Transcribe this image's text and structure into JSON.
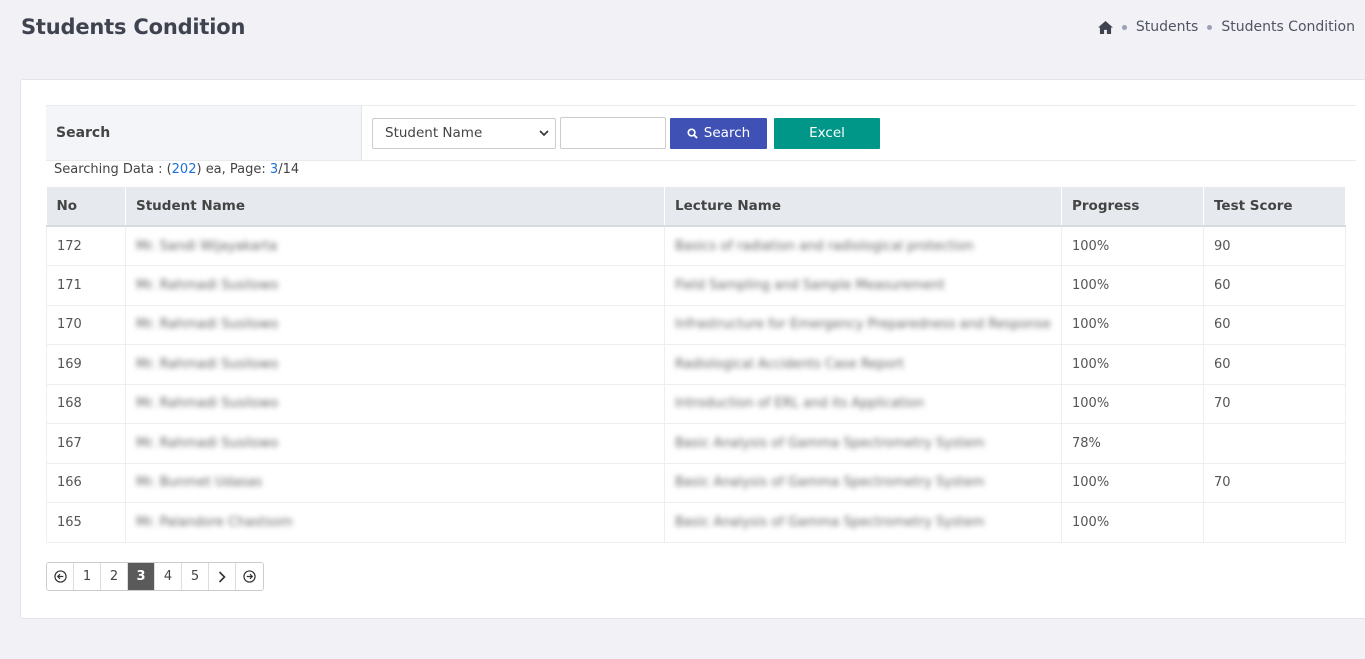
{
  "page": {
    "title": "Students Condition"
  },
  "breadcrumb": {
    "items": [
      "Students",
      "Students Condition"
    ]
  },
  "search": {
    "label": "Search",
    "select_value": "Student Name",
    "input_value": "",
    "search_button": "Search",
    "excel_button": "Excel"
  },
  "summary": {
    "prefix": "Searching Data : (",
    "count": "202",
    "mid": ") ea, Page: ",
    "page": "3",
    "suffix": "/14"
  },
  "table": {
    "headers": [
      "No",
      "Student Name",
      "Lecture Name",
      "Progress",
      "Test Score"
    ],
    "rows": [
      {
        "no": "172",
        "student": "Mr. Sandi Wijayakarta",
        "lecture": "Basics of radiation and radiological protection",
        "progress": "100%",
        "score": "90"
      },
      {
        "no": "171",
        "student": "Mr. Rahmadi Susilowo",
        "lecture": "Field Sampling and Sample Measurement",
        "progress": "100%",
        "score": "60"
      },
      {
        "no": "170",
        "student": "Mr. Rahmadi Susilowo",
        "lecture": "Infrastructure for Emergency Preparedness and Response",
        "progress": "100%",
        "score": "60"
      },
      {
        "no": "169",
        "student": "Mr. Rahmadi Susilowo",
        "lecture": "Radiological Accidents Case Report",
        "progress": "100%",
        "score": "60"
      },
      {
        "no": "168",
        "student": "Mr. Rahmadi Susilowo",
        "lecture": "Introduction of ERL and its Application",
        "progress": "100%",
        "score": "70"
      },
      {
        "no": "167",
        "student": "Mr. Rahmadi Susilowo",
        "lecture": "Basic Analysis of Gamma Spectrometry System",
        "progress": "78%",
        "score": ""
      },
      {
        "no": "166",
        "student": "Mr. Bunmet Udasas",
        "lecture": "Basic Analysis of Gamma Spectrometry System",
        "progress": "100%",
        "score": "70"
      },
      {
        "no": "165",
        "student": "Mr. Palandore Chastsom",
        "lecture": "Basic Analysis of Gamma Spectrometry System",
        "progress": "100%",
        "score": ""
      }
    ]
  },
  "pagination": {
    "pages": [
      "1",
      "2",
      "3",
      "4",
      "5"
    ],
    "current": "3"
  }
}
